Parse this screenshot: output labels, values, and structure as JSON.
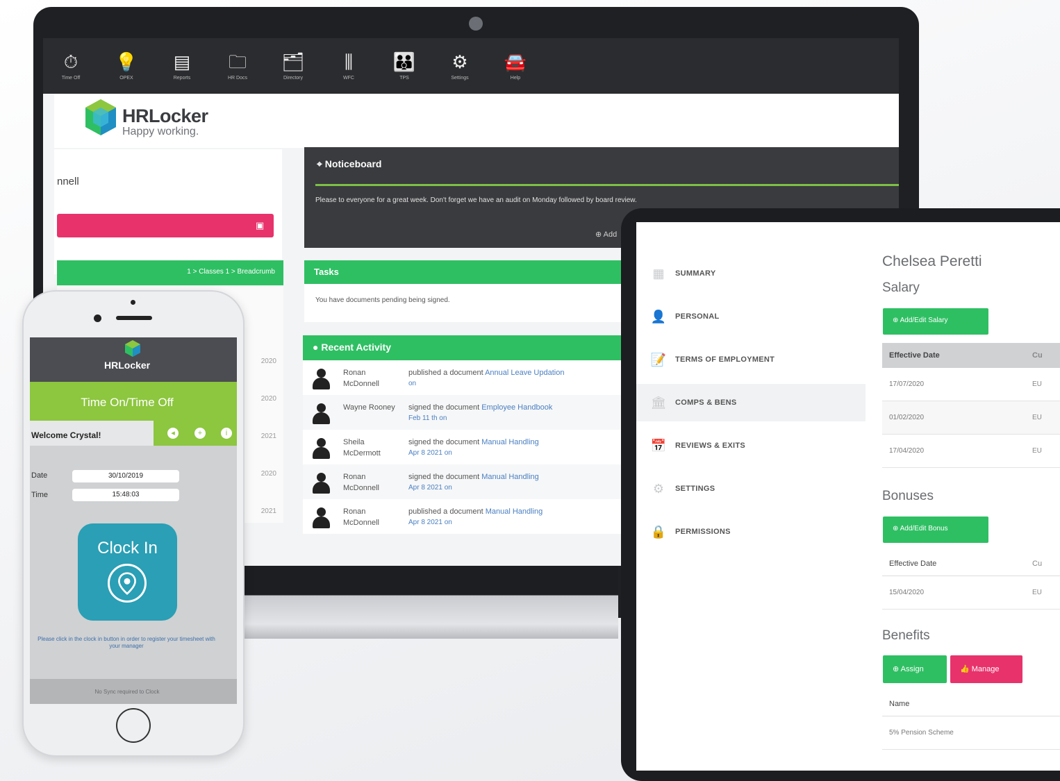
{
  "laptop": {
    "topbar": [
      {
        "icon": "time-off-icon",
        "glyph": "⏱",
        "label": "Time Off"
      },
      {
        "icon": "lightbulb-icon",
        "glyph": "💡",
        "label": "OPEX"
      },
      {
        "icon": "reports-icon",
        "glyph": "▤",
        "label": "Reports"
      },
      {
        "icon": "hr-docs-icon",
        "glyph": "🗀",
        "label": "HR Docs"
      },
      {
        "icon": "directory-icon",
        "glyph": "🗂",
        "label": "Directory"
      },
      {
        "icon": "settings-sliders-icon",
        "glyph": "⫼",
        "label": "WFC"
      },
      {
        "icon": "people-icon",
        "glyph": "👪",
        "label": "TPS"
      },
      {
        "icon": "gear-icon",
        "glyph": "⚙",
        "label": "Settings"
      },
      {
        "icon": "car-icon",
        "glyph": "🚘",
        "label": "Help"
      }
    ],
    "brand": {
      "name": "HRLocker",
      "tagline": "Happy working."
    },
    "left_panel": {
      "name_fragment": "nnell",
      "green_bar_text": "1 > Classes 1 > Breadcrumb",
      "list_values": [
        "2020",
        "2020",
        "2021",
        "2020",
        "2021"
      ]
    },
    "noticeboard": {
      "title": "Noticeboard",
      "message": "Please to everyone for a great week. Don't forget we have an audit on Monday followed by board review.",
      "add_label": "Add"
    },
    "tasks": {
      "title": "Tasks",
      "message": "You have documents pending being signed."
    },
    "recent_activity": {
      "title": "Recent Activity",
      "rows": [
        {
          "name": "Ronan McDonnell",
          "action": "published a document",
          "doc": "Annual Leave Updation",
          "date": "on"
        },
        {
          "name": "Wayne Rooney",
          "action": "signed the document",
          "doc": "Employee Handbook",
          "date": "Feb 11 th on"
        },
        {
          "name": "Sheila McDermott",
          "action": "signed the document",
          "doc": "Manual Handling",
          "date": "Apr 8 2021 on"
        },
        {
          "name": "Ronan McDonnell",
          "action": "signed the document",
          "doc": "Manual Handling",
          "date": "Apr 8 2021 on"
        },
        {
          "name": "Ronan McDonnell",
          "action": "published a document",
          "doc": "Manual Handling",
          "date": "Apr 8 2021 on"
        }
      ]
    }
  },
  "phone": {
    "brand": "HRLocker",
    "title": "Time On/Time Off",
    "welcome": "Welcome Crystal!",
    "date_label": "Date",
    "date_value": "30/10/2019",
    "time_label": "Time",
    "time_value": "15:48:03",
    "clock_label": "Clock In",
    "note": "Please click in the clock in button in order to register your timesheet with your manager",
    "bottom_text": "No Sync required to Clock"
  },
  "tablet": {
    "nav": [
      {
        "icon": "summary-icon",
        "glyph": "▦",
        "label": "SUMMARY"
      },
      {
        "icon": "person-icon",
        "glyph": "👤",
        "label": "PERSONAL"
      },
      {
        "icon": "document-icon",
        "glyph": "📝",
        "label": "TERMS OF EMPLOYMENT"
      },
      {
        "icon": "bank-icon",
        "glyph": "🏛",
        "label": "COMPS & BENS"
      },
      {
        "icon": "calendar-icon",
        "glyph": "📅",
        "label": "REVIEWS & EXITS"
      },
      {
        "icon": "gear-icon",
        "glyph": "⚙",
        "label": "SETTINGS"
      },
      {
        "icon": "lock-icon",
        "glyph": "🔒",
        "label": "PERMISSIONS"
      }
    ],
    "employee_name": "Chelsea Peretti",
    "salary": {
      "title": "Salary",
      "button": "Add/Edit Salary",
      "headers": [
        "Effective Date",
        "Cu"
      ],
      "rows": [
        {
          "date": "17/07/2020",
          "cur": "EU"
        },
        {
          "date": "01/02/2020",
          "cur": "EU"
        },
        {
          "date": "17/04/2020",
          "cur": "EU"
        }
      ]
    },
    "bonuses": {
      "title": "Bonuses",
      "button": "Add/Edit Bonus",
      "headers": [
        "Effective Date",
        "Cu"
      ],
      "rows": [
        {
          "date": "15/04/2020",
          "cur": "EU"
        }
      ]
    },
    "benefits": {
      "title": "Benefits",
      "assign_button": "Assign",
      "manage_button": "Manage",
      "header": "Name",
      "rows": [
        "5% Pension Scheme"
      ]
    }
  },
  "colors": {
    "green": "#2fbf63",
    "lime": "#8dc63f",
    "pink": "#e8326c",
    "teal": "#2a9fb5",
    "dark": "#2b2c2f"
  }
}
